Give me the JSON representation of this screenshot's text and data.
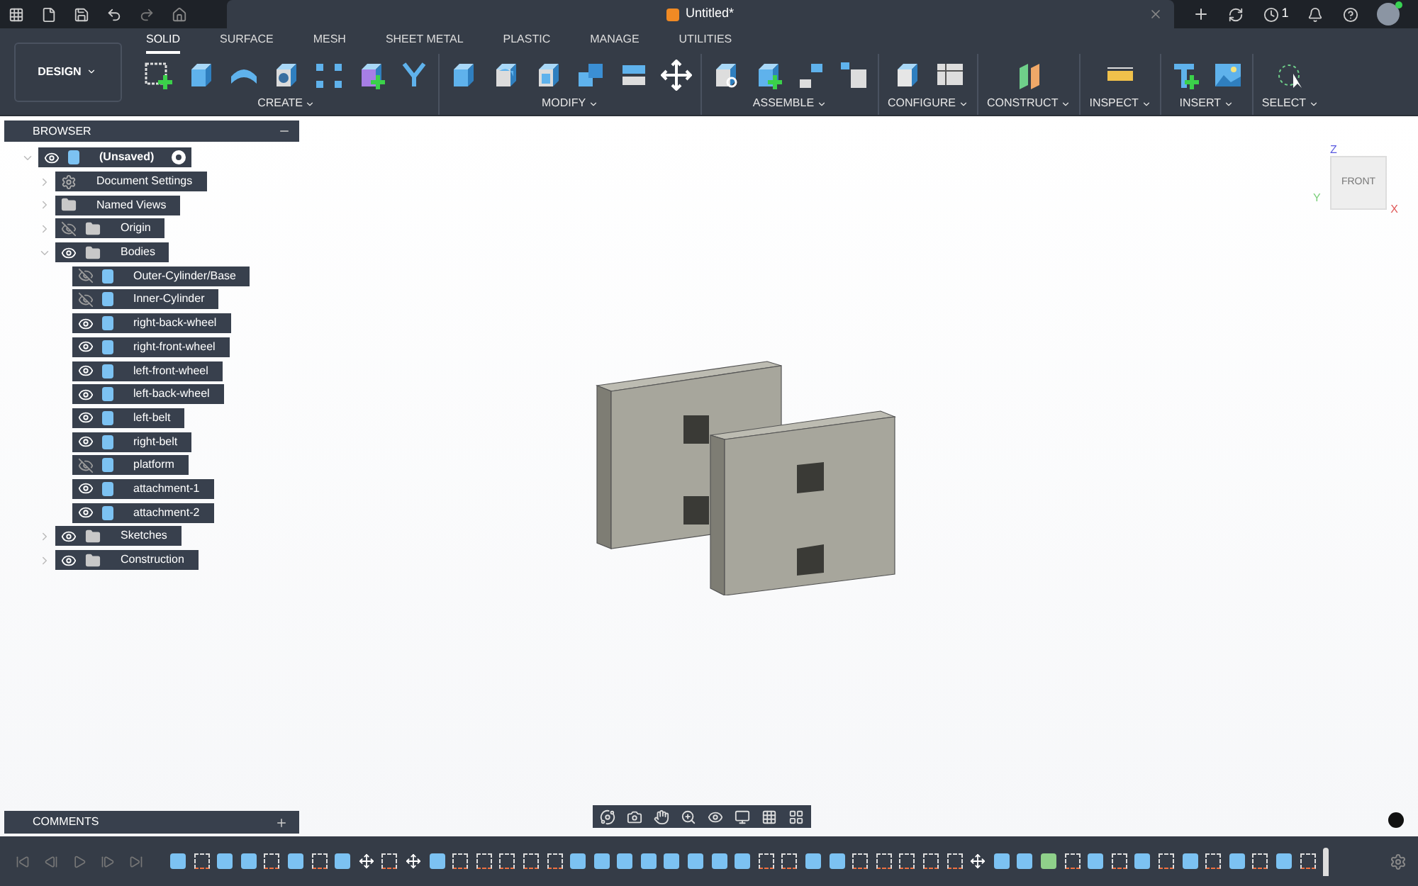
{
  "app_bar": {
    "document_title": "Untitled*",
    "job_count": "1"
  },
  "ribbon": {
    "workspace": "DESIGN",
    "tabs": [
      {
        "label": "SOLID",
        "selected": true
      },
      {
        "label": "SURFACE",
        "selected": false
      },
      {
        "label": "MESH",
        "selected": false
      },
      {
        "label": "SHEET METAL",
        "selected": false
      },
      {
        "label": "PLASTIC",
        "selected": false
      },
      {
        "label": "MANAGE",
        "selected": false
      },
      {
        "label": "UTILITIES",
        "selected": false
      }
    ],
    "groups": [
      {
        "label": "CREATE"
      },
      {
        "label": "MODIFY"
      },
      {
        "label": "ASSEMBLE"
      },
      {
        "label": "CONFIGURE"
      },
      {
        "label": "CONSTRUCT"
      },
      {
        "label": "INSPECT"
      },
      {
        "label": "INSERT"
      },
      {
        "label": "SELECT"
      }
    ]
  },
  "browser": {
    "title": "BROWSER",
    "root": {
      "label": "(Unsaved)",
      "kind": "component",
      "visible": true,
      "expanded": true,
      "active": true,
      "children": [
        {
          "label": "Document Settings",
          "kind": "settings",
          "expanded": false
        },
        {
          "label": "Named Views",
          "kind": "folder",
          "expanded": false
        },
        {
          "label": "Origin",
          "kind": "folder",
          "visible": false,
          "expanded": false
        },
        {
          "label": "Bodies",
          "kind": "folder",
          "visible": true,
          "expanded": true,
          "children": [
            {
              "label": "Outer-Cylinder/Base",
              "kind": "body",
              "visible": false
            },
            {
              "label": "Inner-Cylinder",
              "kind": "body",
              "visible": false
            },
            {
              "label": "right-back-wheel",
              "kind": "body",
              "visible": true
            },
            {
              "label": "right-front-wheel",
              "kind": "body",
              "visible": true
            },
            {
              "label": "left-front-wheel",
              "kind": "body",
              "visible": true
            },
            {
              "label": "left-back-wheel",
              "kind": "body",
              "visible": true
            },
            {
              "label": "left-belt",
              "kind": "body",
              "visible": true
            },
            {
              "label": "right-belt",
              "kind": "body",
              "visible": true
            },
            {
              "label": "platform",
              "kind": "body",
              "visible": false
            },
            {
              "label": "attachment-1",
              "kind": "body",
              "visible": true
            },
            {
              "label": "attachment-2",
              "kind": "body",
              "visible": true
            }
          ]
        },
        {
          "label": "Sketches",
          "kind": "folder",
          "visible": true,
          "expanded": false
        },
        {
          "label": "Construction",
          "kind": "folder",
          "visible": true,
          "expanded": false
        }
      ]
    }
  },
  "view_cube": {
    "face": "FRONT",
    "axes": [
      "Z",
      "X",
      "Y"
    ]
  },
  "comments": {
    "title": "COMMENTS"
  }
}
